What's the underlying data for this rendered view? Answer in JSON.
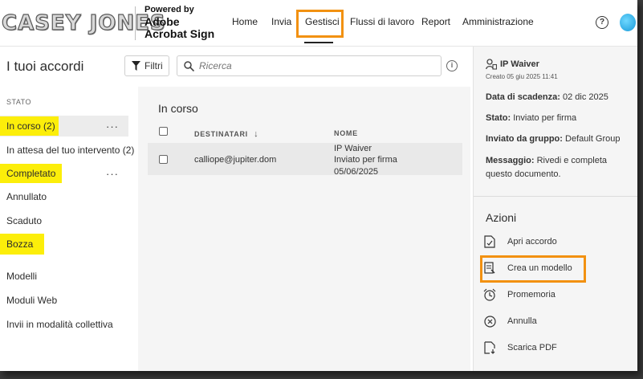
{
  "header": {
    "logo_text": "CASEY JONES",
    "powered_by": "Powered by",
    "brand_line1": "Adobe",
    "brand_line2": "Acrobat Sign",
    "nav": [
      {
        "label": "Home"
      },
      {
        "label": "Invia"
      },
      {
        "label": "Gestisci",
        "active": true
      },
      {
        "label": "Flussi di lavoro"
      },
      {
        "label": "Report"
      },
      {
        "label": "Amministrazione"
      }
    ],
    "help_glyph": "?"
  },
  "toolbar": {
    "title": "I tuoi accordi",
    "filter_label": "Filtri",
    "search_placeholder": "Ricerca",
    "info_glyph": "i"
  },
  "sidebar": {
    "status_header": "STATO",
    "items": [
      {
        "label": "In corso (2)",
        "highlighted": true,
        "selected": true,
        "menu": "···"
      },
      {
        "label": "In attesa del tuo intervento (2)"
      },
      {
        "label": "Completato",
        "highlighted": true,
        "menu": "···"
      },
      {
        "label": "Annullato"
      },
      {
        "label": "Scaduto"
      },
      {
        "label": "Bozza",
        "highlighted": true
      }
    ],
    "extra_items": [
      {
        "label": "Modelli"
      },
      {
        "label": "Moduli Web"
      },
      {
        "label": "Invii in modalità collettiva"
      }
    ]
  },
  "list": {
    "title": "In corso",
    "columns": {
      "recipients": "DESTINATARI",
      "sort_glyph": "↓",
      "name": "NOME"
    },
    "rows": [
      {
        "recipient": "calliope@jupiter.dom",
        "name": "IP Waiver",
        "status": "Inviato per firma",
        "date": "05/06/2025"
      }
    ]
  },
  "details": {
    "title": "IP Waiver",
    "created": "Creato 05 giu 2025 11:41",
    "fields": [
      {
        "label": "Data di scadenza:",
        "value": "02 dic 2025"
      },
      {
        "label": "Stato:",
        "value": "Inviato per firma"
      },
      {
        "label": "Inviato da gruppo:",
        "value": "Default Group"
      },
      {
        "label": "Messaggio:",
        "value": "Rivedi e completa questo documento."
      }
    ],
    "actions_title": "Azioni",
    "actions": [
      {
        "label": "Apri accordo",
        "icon": "open-document-icon"
      },
      {
        "label": "Crea un modello",
        "icon": "create-template-icon",
        "highlighted": true
      },
      {
        "label": "Promemoria",
        "icon": "reminder-icon"
      },
      {
        "label": "Annulla",
        "icon": "cancel-icon"
      },
      {
        "label": "Scarica PDF",
        "icon": "download-pdf-icon"
      }
    ]
  },
  "colors": {
    "highlight_yellow": "#fcee0a",
    "annotation_orange": "#f29111",
    "avatar_blue": "#1799d8"
  }
}
